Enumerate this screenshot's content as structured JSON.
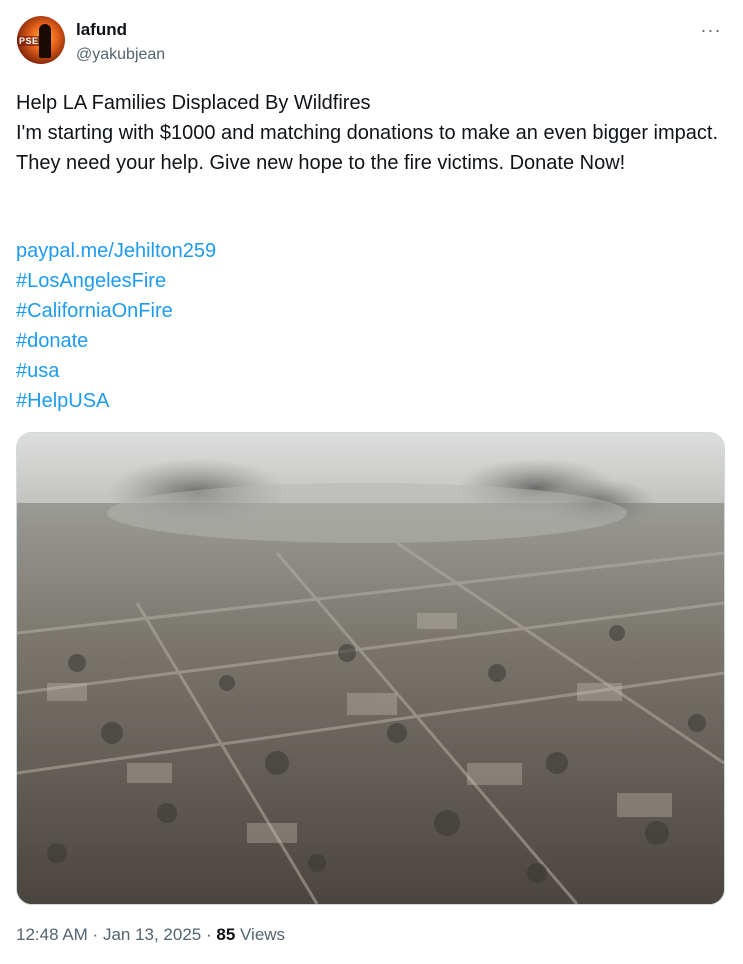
{
  "author": {
    "display_name": "lafund",
    "handle": "@yakubjean",
    "avatar_badge": "PSE"
  },
  "more_label": "···",
  "tweet": {
    "line1": "Help LA Families Displaced By Wildfires",
    "line2": "I'm starting with $1000 and matching donations to make an even bigger impact. They need your help. Give new hope to the fire victims. Donate Now!"
  },
  "links": [
    "paypal.me/Jehilton259",
    "#LosAngelesFire",
    "#CaliforniaOnFire",
    "#donate",
    "#usa",
    "#HelpUSA"
  ],
  "meta": {
    "time": "12:48 AM",
    "sep1": " · ",
    "date": "Jan 13, 2025",
    "sep2": " · ",
    "views_count": "85",
    "views_label": " Views"
  },
  "colors": {
    "link": "#1d9bf0",
    "secondary": "#536471",
    "primary": "#0f1419"
  }
}
